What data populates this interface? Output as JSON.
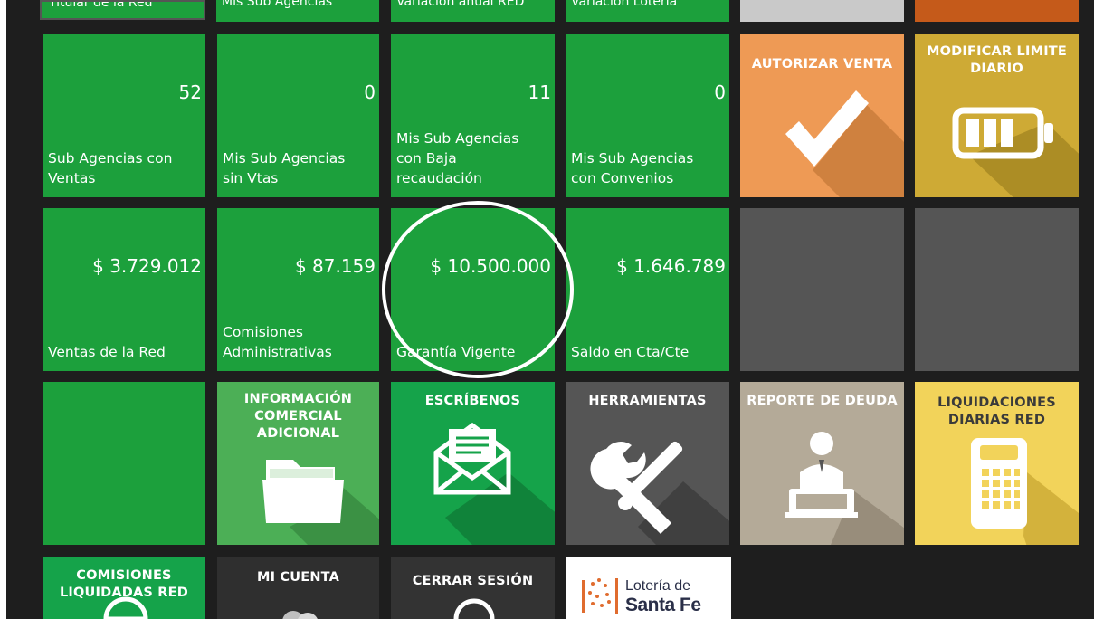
{
  "top_strip": [
    "Titular de la Red",
    "Mis Sub Agencias",
    "Variación anual RED",
    "Variación Lotería"
  ],
  "stats_row1": [
    {
      "value": "52",
      "label": "Sub Agencias con Ventas"
    },
    {
      "value": "0",
      "label": "Mis Sub Agencias sin Vtas"
    },
    {
      "value": "11",
      "label": "Mis Sub Agencias con Baja recaudación"
    },
    {
      "value": "0",
      "label": "Mis Sub Agencias con Convenios"
    }
  ],
  "stats_row2": [
    {
      "value": "$ 3.729.012",
      "label": "Ventas de la Red"
    },
    {
      "value": "$ 87.159",
      "label": "Comisiones Administrativas"
    },
    {
      "value": "$ 10.500.000",
      "label": "Garantía Vigente"
    },
    {
      "value": "$ 1.646.789",
      "label": "Saldo en Cta/Cte"
    }
  ],
  "actions": {
    "autorizar_venta": "AUTORIZAR VENTA",
    "modificar_limite": "MODIFICAR LIMITE DIARIO",
    "informacion_comercial": "INFORMACIÓN COMERCIAL ADICIONAL",
    "escribenos": "ESCRÍBENOS",
    "herramientas": "HERRAMIENTAS",
    "reporte_deuda": "REPORTE DE DEUDA",
    "liquidaciones": "LIQUIDACIONES DIARIAS RED",
    "comisiones_liquidadas": "COMISIONES LIQUIDADAS RED",
    "mi_cuenta": "MI CUENTA",
    "cerrar_sesion": "CERRAR SESIÓN"
  },
  "logo": {
    "line1": "Lotería de",
    "line2": "Santa Fe"
  },
  "colors": {
    "background": "#1e1e1e",
    "stat_green": "#1ca03c",
    "orange": "#ee9a55",
    "gold": "#ceaa35",
    "gray": "#555555",
    "taupe": "#b4aa98",
    "yellow": "#f2d35a",
    "highlight_circle": "#ffffff"
  },
  "icons": [
    "checkmark-icon",
    "battery-icon",
    "folder-icon",
    "envelope-icon",
    "tools-icon",
    "presenter-icon",
    "calculator-icon",
    "user-icon",
    "power-icon",
    "coins-icon"
  ]
}
